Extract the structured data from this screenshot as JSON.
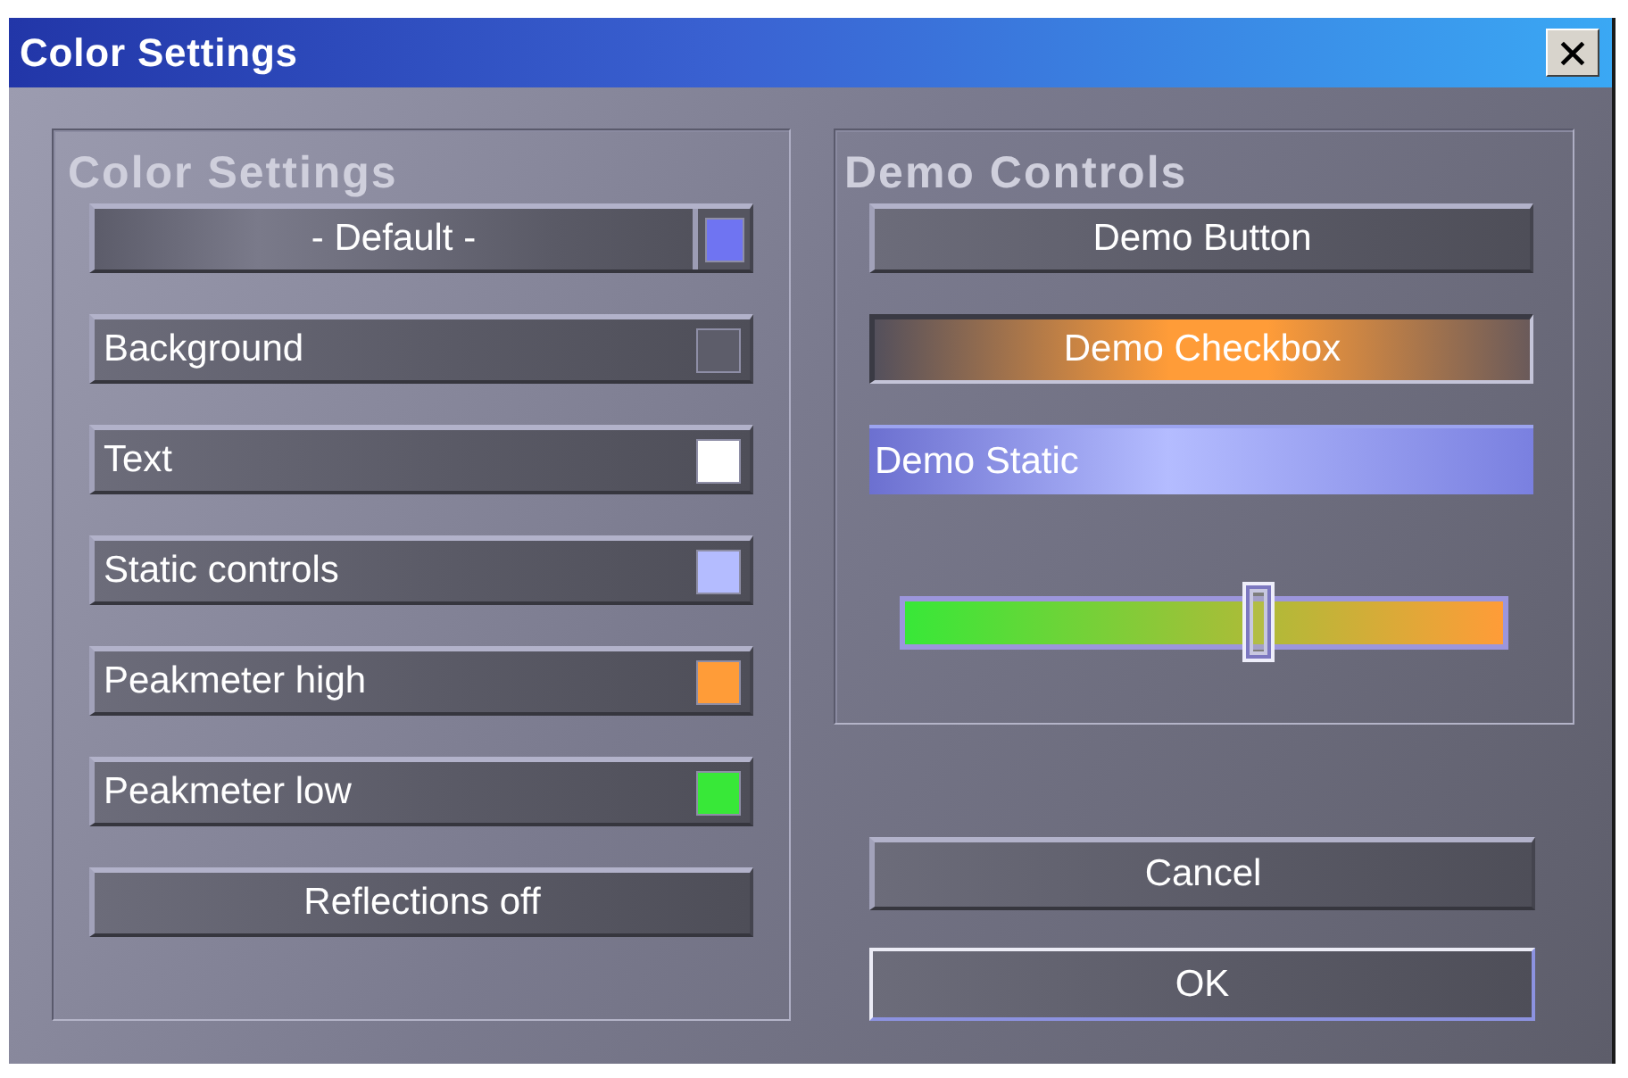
{
  "window": {
    "title": "Color Settings"
  },
  "color_settings": {
    "title": "Color Settings",
    "scheme": {
      "label": "- Default -",
      "color": "#6f74f2"
    },
    "items": [
      {
        "label": "Background",
        "color": "#5d5d6a"
      },
      {
        "label": "Text",
        "color": "#ffffff"
      },
      {
        "label": "Static controls",
        "color": "#b4bcff"
      },
      {
        "label": "Peakmeter high",
        "color": "#ff9c38"
      },
      {
        "label": "Peakmeter low",
        "color": "#38e838"
      }
    ],
    "reflections_button": "Reflections off"
  },
  "demo_controls": {
    "title": "Demo Controls",
    "button": "Demo Button",
    "checkbox": {
      "label": "Demo Checkbox",
      "checked": true
    },
    "static": "Demo Static",
    "slider": {
      "level": 0.59
    }
  },
  "buttons": [
    {
      "label": "Cancel",
      "focused": false
    },
    {
      "label": "OK",
      "focused": true
    }
  ]
}
